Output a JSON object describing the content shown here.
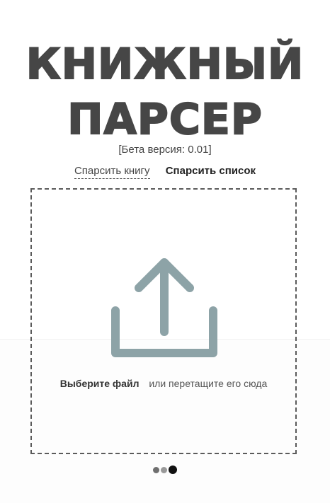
{
  "header": {
    "title_line1": "КНИЖНЫЙ",
    "title_line2": "ПАРСЕР",
    "beta": "[Бета версия: 0.01]"
  },
  "tabs": [
    {
      "label": "Спарсить книгу",
      "active": false
    },
    {
      "label": "Спарсить список",
      "active": true
    }
  ],
  "dropzone": {
    "icon": "upload-icon",
    "choose_label": "Выберите файл",
    "drag_text": "или перетащите его сюда"
  },
  "pagination": {
    "count": 3,
    "active_index": 3
  },
  "colors": {
    "title": "#464646",
    "icon": "#8da3a7",
    "border": "#5b5b5b",
    "active_dot": "#111111"
  }
}
